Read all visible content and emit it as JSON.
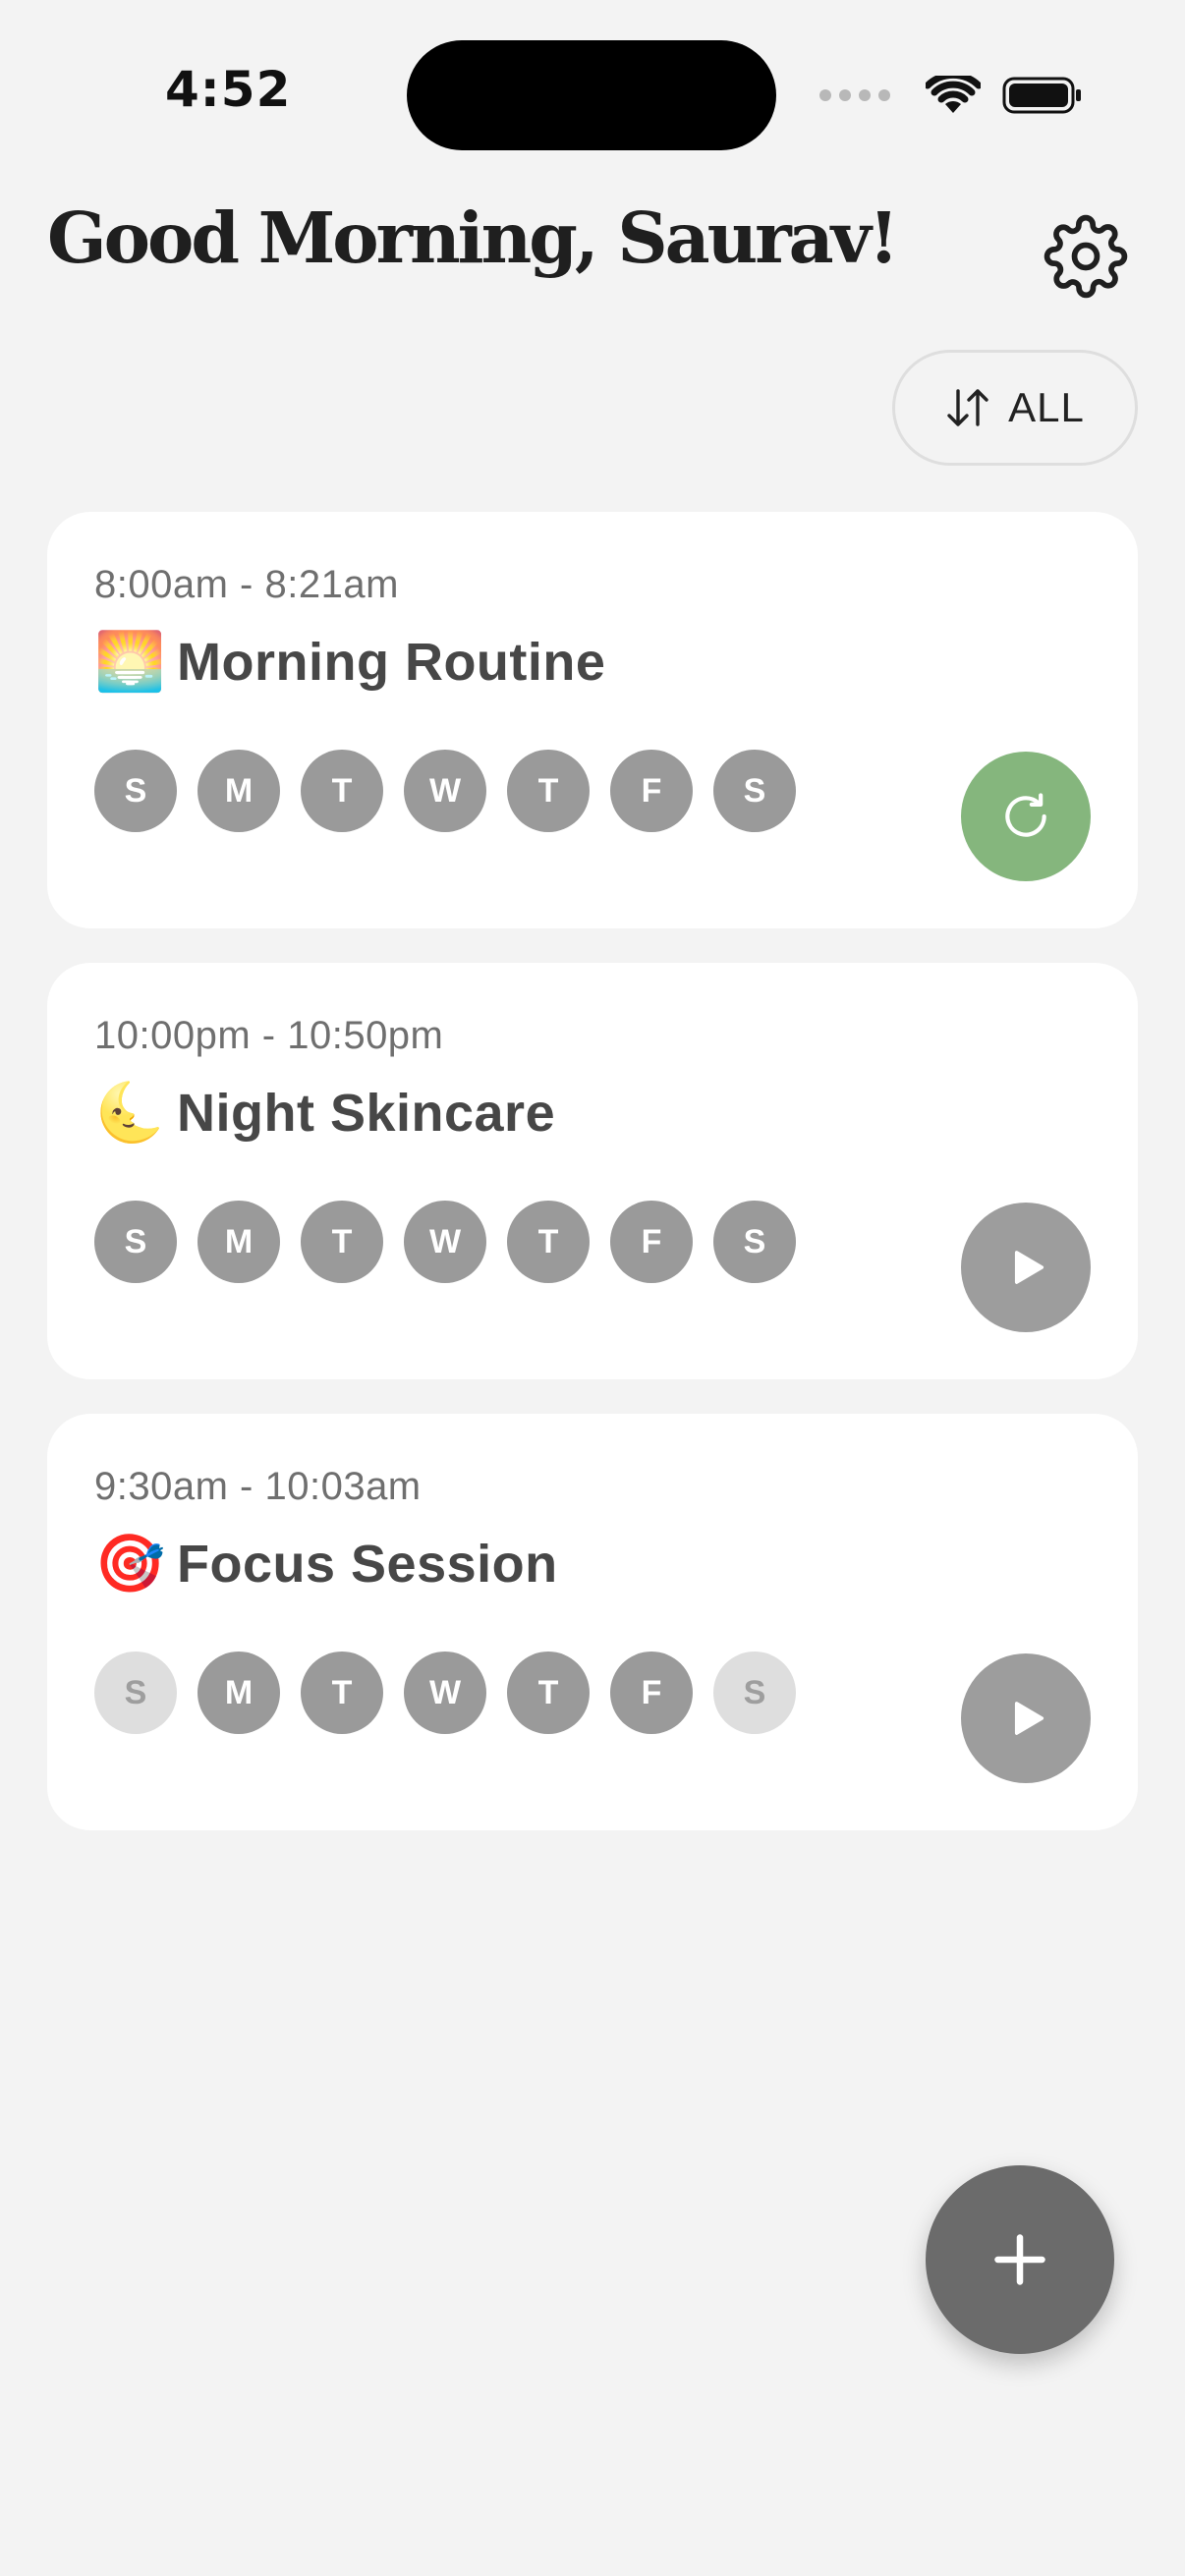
{
  "status_bar": {
    "time": "4:52",
    "icons": [
      "signal-icon",
      "wifi-icon",
      "battery-icon"
    ]
  },
  "header": {
    "greeting": "Good Morning, Saurav!",
    "settings_icon": "gear-icon"
  },
  "filter": {
    "label": "ALL",
    "icon": "sort-arrows-icon"
  },
  "routines": [
    {
      "time": "8:00am - 8:21am",
      "emoji": "🌅",
      "title": "Morning Routine",
      "days": [
        {
          "label": "S",
          "active": true
        },
        {
          "label": "M",
          "active": true
        },
        {
          "label": "T",
          "active": true
        },
        {
          "label": "W",
          "active": true
        },
        {
          "label": "T",
          "active": true
        },
        {
          "label": "F",
          "active": true
        },
        {
          "label": "S",
          "active": true
        }
      ],
      "action": "replay-icon",
      "action_color": "#85b67d"
    },
    {
      "time": "10:00pm - 10:50pm",
      "emoji": "🌜",
      "title": "Night Skincare",
      "days": [
        {
          "label": "S",
          "active": true
        },
        {
          "label": "M",
          "active": true
        },
        {
          "label": "T",
          "active": true
        },
        {
          "label": "W",
          "active": true
        },
        {
          "label": "T",
          "active": true
        },
        {
          "label": "F",
          "active": true
        },
        {
          "label": "S",
          "active": true
        }
      ],
      "action": "play-icon",
      "action_color": "#9d9d9d"
    },
    {
      "time": "9:30am - 10:03am",
      "emoji": "🎯",
      "title": "Focus Session",
      "days": [
        {
          "label": "S",
          "active": false
        },
        {
          "label": "M",
          "active": true
        },
        {
          "label": "T",
          "active": true
        },
        {
          "label": "W",
          "active": true
        },
        {
          "label": "T",
          "active": true
        },
        {
          "label": "F",
          "active": true
        },
        {
          "label": "S",
          "active": false
        }
      ],
      "action": "play-icon",
      "action_color": "#9d9d9d"
    }
  ],
  "fab": {
    "icon": "plus-icon"
  },
  "colors": {
    "background": "#f3f3f3",
    "card": "#ffffff",
    "day_active": "#9a9a9a",
    "day_inactive": "#dedede",
    "accent_green": "#85b67d",
    "fab": "#6b6b6b"
  }
}
